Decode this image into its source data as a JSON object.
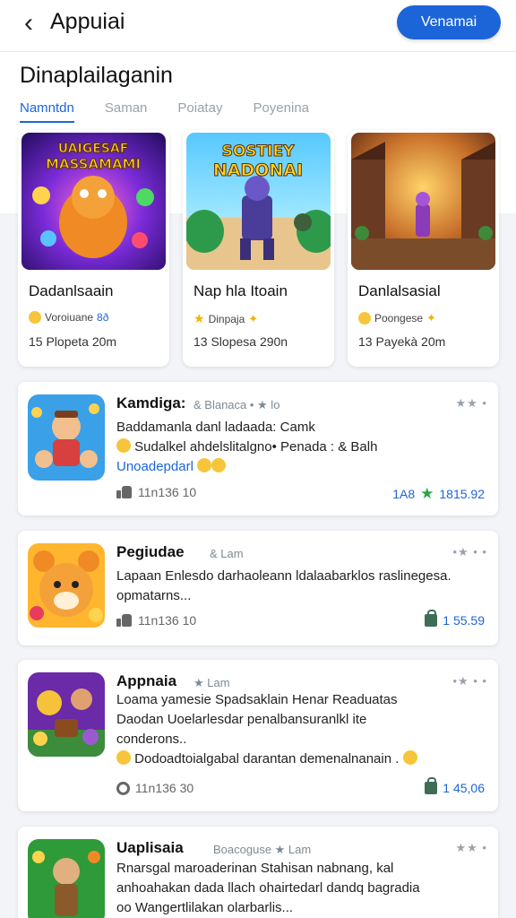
{
  "appbar": {
    "title": "Appuiai",
    "button_label": "Venamai"
  },
  "section": {
    "title": "Dinaplailaganin"
  },
  "tabs": [
    {
      "label": "Namntdn",
      "active": true
    },
    {
      "label": "Saman"
    },
    {
      "label": "Poiatay"
    },
    {
      "label": "Poyenina"
    }
  ],
  "featured": [
    {
      "image_text": [
        "UAIGESAF",
        "MASSAMAMI"
      ],
      "name": "Dadanlsaain",
      "meta": "Voroiuane",
      "meta_suffix": "8ð",
      "count": "15 Plopeta 20m"
    },
    {
      "image_text": [
        "SOSTIEY",
        "NADONAI"
      ],
      "name": "Nap hla Itoain",
      "meta": "Dinpaja",
      "meta_suffix": "",
      "count": "13 Slopesa 290n"
    },
    {
      "image_text": [],
      "name": "Danlalsasial",
      "meta": "Poongese",
      "meta_suffix": "",
      "count": "13 Payekà 20m"
    }
  ],
  "list": [
    {
      "name": "Kamdiga:",
      "tags": "& Blanaca • ★ lo",
      "more": "★★ •",
      "desc_lines": [
        "Baddamanla danl ladaada: Camk",
        "Sudalkel ahdelslitalgno• Penada : & Balh"
      ],
      "desc_highlight": "Unoadepdarl",
      "foot": "11n136 10",
      "right_label": "1A8",
      "right_value": "1815.92"
    },
    {
      "name": "Pegiudae",
      "tags": "& Lam",
      "more": "•★ • •",
      "desc_lines": [
        "Lapaan Enlesdo darhaoleann ldalaabarklos raslinegesa.",
        "opmatarns..."
      ],
      "desc_highlight": "",
      "foot": "11n136 10",
      "right_label": "",
      "right_value": "1 55.59"
    },
    {
      "name": "Appnaia",
      "tags": "★ Lam",
      "more": "•★ • •",
      "desc_lines": [
        "Loama yamesie Spadsaklain Henar Readuatas",
        "Daodan Uoelarlesdar penalbansuranlkl ite",
        "conderons..",
        "Dodoadtoialgabal darantan demenalnanain ."
      ],
      "desc_highlight": "",
      "foot": "11n136 30",
      "right_label": "",
      "right_value": "1 45,06"
    },
    {
      "name": "Uaplisaia",
      "tags": "Boacoguse ★ Lam",
      "more": "★★ •",
      "desc_lines": [
        "Rnarsgal maroaderinan Stahisan nabnang, kal",
        "anhoahakan dada llach ohairtedarl dandq bagradia",
        "oo Wangertlilakan olarbarlis..."
      ],
      "desc_highlight": "",
      "foot": "",
      "right_label": "",
      "right_value": ""
    }
  ],
  "colors": {
    "accent": "#1c65d9",
    "green": "#2aa544",
    "background": "#f2f4f7"
  }
}
